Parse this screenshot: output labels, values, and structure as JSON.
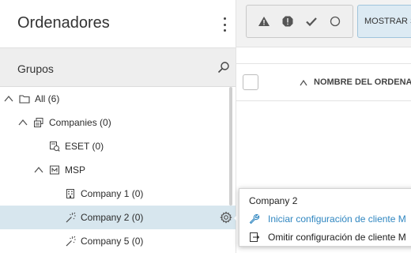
{
  "panel": {
    "title": "Ordenadores",
    "groups_label": "Grupos"
  },
  "tree": [
    {
      "label": "All (6)",
      "icon": "folder-icon",
      "chevron": "up",
      "level": 0
    },
    {
      "label": "Companies (0)",
      "icon": "static-group-icon",
      "chevron": "up",
      "level": 1
    },
    {
      "label": "ESET (0)",
      "icon": "dynamic-group-icon",
      "chevron": "none",
      "level": 2
    },
    {
      "label": "MSP",
      "icon": "msp-icon",
      "chevron": "up",
      "level": 2
    },
    {
      "label": "Company 1 (0)",
      "icon": "building-icon",
      "chevron": "none",
      "level": 3
    },
    {
      "label": "Company 2 (0)",
      "icon": "wand-icon",
      "chevron": "none",
      "level": 3,
      "selected": true
    },
    {
      "label": "Company 5 (0)",
      "icon": "wand-icon",
      "chevron": "none",
      "level": 3
    }
  ],
  "toolbar": {
    "filters": [
      "warning-icon",
      "error-icon",
      "check-icon",
      "circle-icon"
    ],
    "show_button": "MOSTRAR S"
  },
  "table": {
    "column_name": "NOMBRE DEL ORDENA"
  },
  "context_menu": {
    "title": "Company 2",
    "items": [
      {
        "label": "Iniciar configuración de cliente M",
        "icon": "wrench-icon"
      },
      {
        "label": "Omitir configuración de cliente M",
        "icon": "skip-icon"
      }
    ]
  },
  "colors": {
    "selected_row": "#d7e6ee",
    "link": "#2f86c0",
    "show_button_bg": "#dceaf3"
  }
}
